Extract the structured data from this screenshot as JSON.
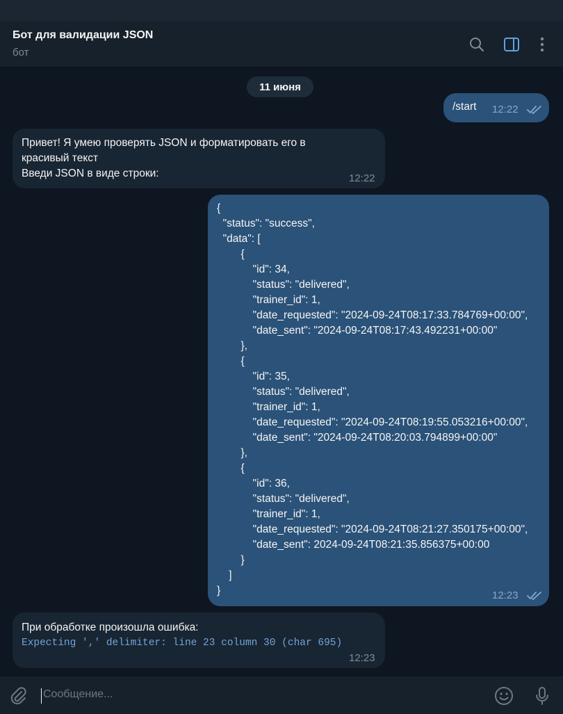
{
  "header": {
    "title": "Бот для валидации JSON",
    "subtitle": "бот",
    "icons": [
      "search-icon",
      "sidebar-toggle-icon",
      "more-vertical-icon"
    ]
  },
  "colors": {
    "background": "#0e1621",
    "header": "#17212b",
    "incoming_bubble": "#182533",
    "outgoing_bubble": "#2b5278",
    "accent": "#5ea2ea"
  },
  "chat": {
    "date_separator": "11 июня",
    "messages": [
      {
        "direction": "outgoing",
        "text": "/start",
        "time": "12:22",
        "read": true
      },
      {
        "direction": "incoming",
        "lines": [
          "Привет! Я умею проверять JSON и форматировать его в",
          "красивый текст",
          "Введи JSON в виде строки:"
        ],
        "time": "12:22"
      },
      {
        "direction": "outgoing",
        "lines": [
          "{",
          "  \"status\": \"success\",",
          "  \"data\": [",
          "        {",
          "            \"id\": 34,",
          "            \"status\": \"delivered\",",
          "            \"trainer_id\": 1,",
          "            \"date_requested\": \"2024-09-24T08:17:33.784769+00:00\",",
          "            \"date_sent\": \"2024-09-24T08:17:43.492231+00:00\"",
          "        },",
          "        {",
          "            \"id\": 35,",
          "            \"status\": \"delivered\",",
          "            \"trainer_id\": 1,",
          "            \"date_requested\": \"2024-09-24T08:19:55.053216+00:00\",",
          "            \"date_sent\": \"2024-09-24T08:20:03.794899+00:00\"",
          "        },",
          "        {",
          "            \"id\": 36,",
          "            \"status\": \"delivered\",",
          "            \"trainer_id\": 1,",
          "            \"date_requested\": \"2024-09-24T08:21:27.350175+00:00\",",
          "            \"date_sent\": 2024-09-24T08:21:35.856375+00:00",
          "        }",
          "    ]",
          "}"
        ],
        "time": "12:23",
        "read": true
      },
      {
        "direction": "incoming",
        "text": "При обработке произошла ошибка:",
        "code": "Expecting ',' delimiter: line 23 column 30 (char 695)",
        "time": "12:23"
      }
    ]
  },
  "composer": {
    "placeholder": "Сообщение...",
    "icons": [
      "paperclip-icon",
      "emoji-icon",
      "microphone-icon"
    ]
  }
}
